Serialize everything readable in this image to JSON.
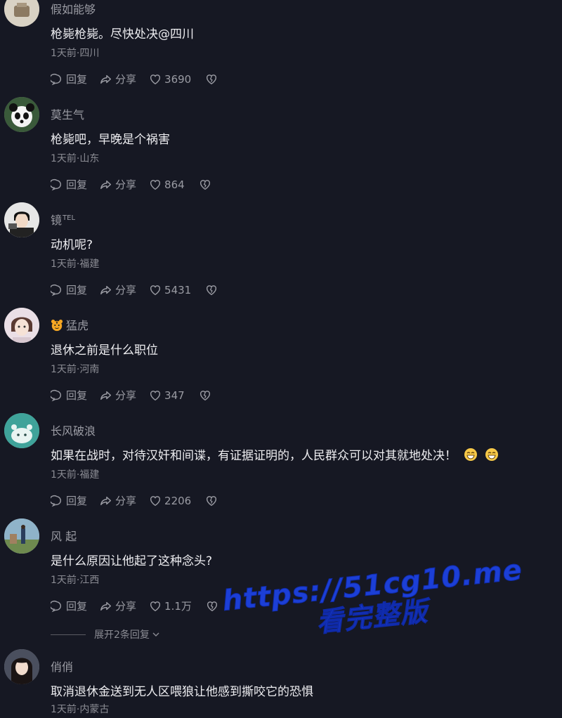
{
  "icons": {
    "reply": "chat-bubble-icon",
    "share": "share-arrow-icon",
    "like": "heart-icon",
    "dislike": "broken-heart-icon"
  },
  "action_labels": {
    "reply": "回复",
    "share": "分享"
  },
  "comments": [
    {
      "name": "假如能够",
      "text": "枪毙枪毙。尽快处决@四川",
      "meta": "1天前·四川",
      "likes": "3690"
    },
    {
      "name": "莫生气",
      "text": "枪毙吧，早晚是个祸害",
      "meta": "1天前·山东",
      "likes": "864"
    },
    {
      "name": "镜",
      "name_sup": "TEL",
      "text": "动机呢?",
      "meta": "1天前·福建",
      "likes": "5431"
    },
    {
      "name": "猛虎",
      "text": "退休之前是什么职位",
      "meta": "1天前·河南",
      "likes": "347"
    },
    {
      "name": "长风破浪",
      "text": "如果在战时，对待汉奸和间谍，有证据证明的，人民群众可以对其就地处决！",
      "meta": "1天前·福建",
      "likes": "2206"
    },
    {
      "name": "风 起",
      "text": "是什么原因让他起了这种念头?",
      "meta": "1天前·江西",
      "likes": "1.1万"
    },
    {
      "name": "俏俏",
      "text": "取消退休金送到无人区喂狼让他感到撕咬它的恐惧",
      "meta": "1天前·内蒙古"
    }
  ],
  "expand_replies": "展开2条回复",
  "watermark": {
    "line1": "https://51cg10.me",
    "line2": "看完整版"
  },
  "colors": {
    "background": "#161823",
    "watermark": "#1c3fd6"
  }
}
